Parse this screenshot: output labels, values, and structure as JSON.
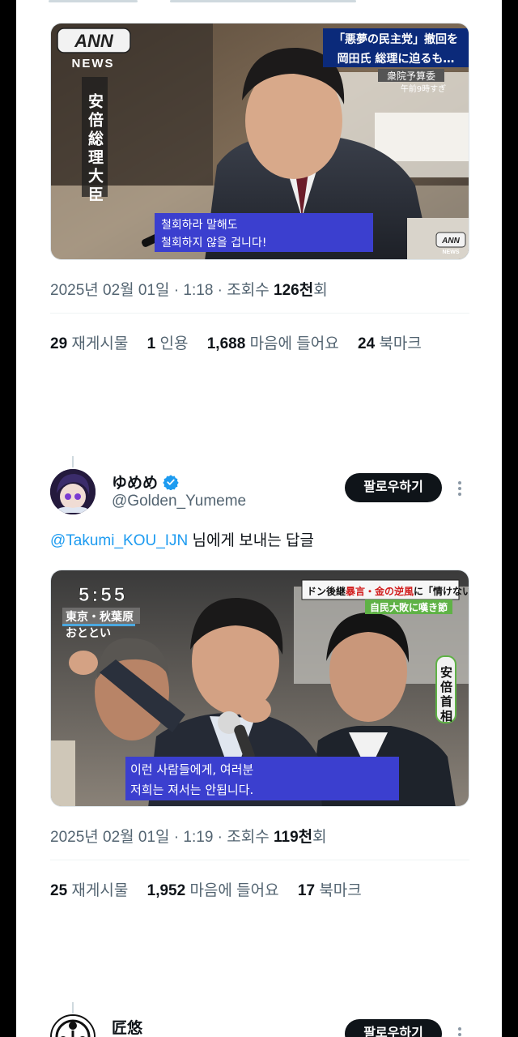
{
  "tweet1": {
    "media": {
      "channel_logo": "ANN",
      "channel_sub": "NEWS",
      "vertical_caption": "安倍総理大臣",
      "headline_1": "「悪夢の民主党」撤回を",
      "headline_2": "岡田氏 総理に迫るも…",
      "headline_3": "衆院予算委",
      "headline_4": "午前9時すぎ",
      "subtitle_1": "철회하라 말해도",
      "subtitle_2": "철회하지 않을 겁니다!",
      "corner_logo": "ANN",
      "corner_logo_sub": "NEWS"
    },
    "timestamp": "2025년 02월 01일 · 1:18 · 조회수 ",
    "views": "126천",
    "views_suffix": "회",
    "stats": {
      "retweets": "29",
      "retweets_label": "재게시물",
      "quotes": "1",
      "quotes_label": "인용",
      "likes": "1,688",
      "likes_label": "마음에 들어요",
      "bookmarks": "24",
      "bookmarks_label": "북마크"
    }
  },
  "tweet2": {
    "display_name": "ゆめめ",
    "handle": "@Golden_Yumeme",
    "follow_label": "팔로우하기",
    "reply_to": "@Takumi_KOU_IJN",
    "reply_suffix": " 님에게 보내는 답글",
    "media": {
      "clock": "5:55",
      "location_1": "東京・秋葉原",
      "location_2": "おととい",
      "headline_1": "ドン後継",
      "headline_1b": "暴言・金の逆風",
      "headline_1c": "に「情けない」",
      "headline_2": "自民大敗に嘆き節",
      "vertical_caption": "安倍首相",
      "subtitle_1": "이런 사람들에게, 여러분",
      "subtitle_2": "저희는 져서는 안됩니다."
    },
    "timestamp": "2025년 02월 01일 · 1:19 · 조회수 ",
    "views": "119천",
    "views_suffix": "회",
    "stats": {
      "retweets": "25",
      "retweets_label": "재게시물",
      "likes": "1,952",
      "likes_label": "마음에 들어요",
      "bookmarks": "17",
      "bookmarks_label": "북마크"
    }
  },
  "tweet3": {
    "display_name": "匠悠",
    "follow_label": "팔로우하기"
  },
  "colors": {
    "link": "#1d9bf0",
    "verified": "#1d9bf0",
    "subtitle_box": "#3b3fcf",
    "button": "#0f1419"
  },
  "icons": [
    "verified-badge-icon",
    "more-options-icon"
  ]
}
